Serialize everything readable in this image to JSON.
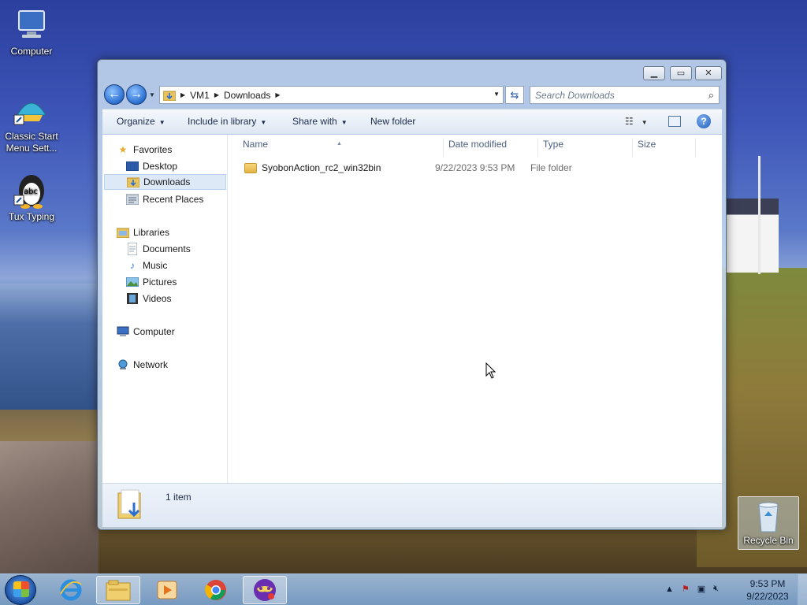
{
  "desktop": {
    "icons": [
      {
        "label": "Computer"
      },
      {
        "label": "Classic Start Menu Sett..."
      },
      {
        "label": "Tux Typing"
      },
      {
        "label": "Recycle Bin"
      }
    ]
  },
  "window": {
    "address": {
      "crumbs": [
        "VM1",
        "Downloads"
      ]
    },
    "search": {
      "placeholder": "Search Downloads"
    },
    "toolbar": {
      "organize": "Organize",
      "include_in_library": "Include in library",
      "share_with": "Share with",
      "new_folder": "New folder"
    },
    "nav": {
      "favorites": "Favorites",
      "desktop": "Desktop",
      "downloads": "Downloads",
      "recent_places": "Recent Places",
      "libraries": "Libraries",
      "documents": "Documents",
      "music": "Music",
      "pictures": "Pictures",
      "videos": "Videos",
      "computer": "Computer",
      "network": "Network"
    },
    "columns": [
      "Name",
      "Date modified",
      "Type",
      "Size"
    ],
    "files": [
      {
        "name": "SyobonAction_rc2_win32bin",
        "date": "9/22/2023 9:53 PM",
        "type": "File folder",
        "size": ""
      }
    ],
    "details": {
      "count": "1 item"
    }
  },
  "taskbar": {
    "clock_time": "9:53 PM",
    "clock_date": "9/22/2023"
  }
}
